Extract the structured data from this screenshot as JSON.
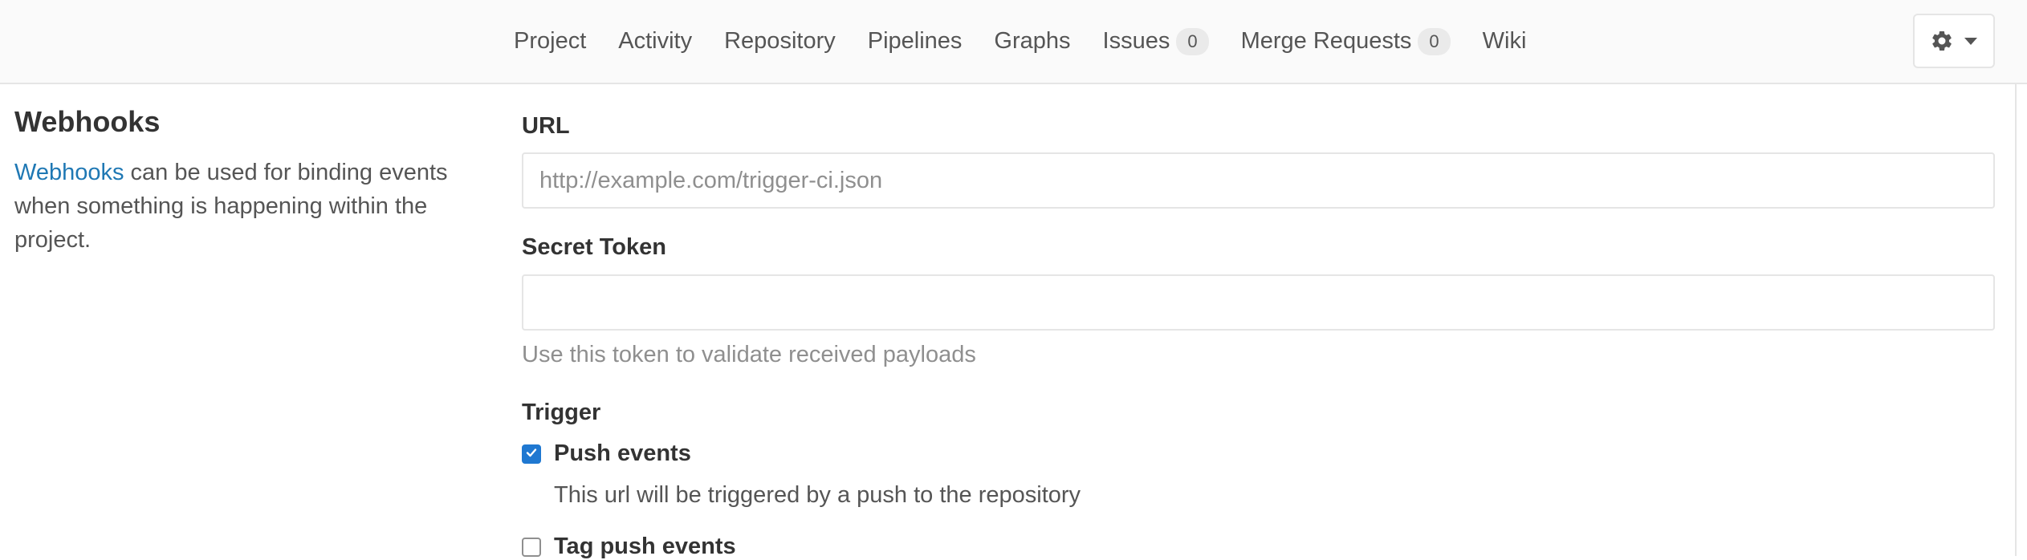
{
  "nav": {
    "items": [
      {
        "label": "Project"
      },
      {
        "label": "Activity"
      },
      {
        "label": "Repository"
      },
      {
        "label": "Pipelines"
      },
      {
        "label": "Graphs"
      },
      {
        "label": "Issues",
        "count": "0"
      },
      {
        "label": "Merge Requests",
        "count": "0"
      },
      {
        "label": "Wiki"
      }
    ],
    "settings_icon": "gear-icon",
    "dropdown_icon": "caret-down-icon"
  },
  "sidebar": {
    "title": "Webhooks",
    "link_text": "Webhooks",
    "description": " can be used for binding events when something is happening within the project."
  },
  "form": {
    "url": {
      "label": "URL",
      "placeholder": "http://example.com/trigger-ci.json",
      "value": ""
    },
    "secret_token": {
      "label": "Secret Token",
      "value": "",
      "help": "Use this token to validate received payloads"
    },
    "trigger": {
      "label": "Trigger",
      "options": [
        {
          "label": "Push events",
          "checked": true,
          "help": "This url will be triggered by a push to the repository"
        },
        {
          "label": "Tag push events",
          "checked": false
        }
      ]
    }
  },
  "colors": {
    "link": "#1f78b4",
    "checkbox_checked": "#1f78d1",
    "topbar_bg": "#fafafa",
    "border": "#e5e5e5"
  }
}
